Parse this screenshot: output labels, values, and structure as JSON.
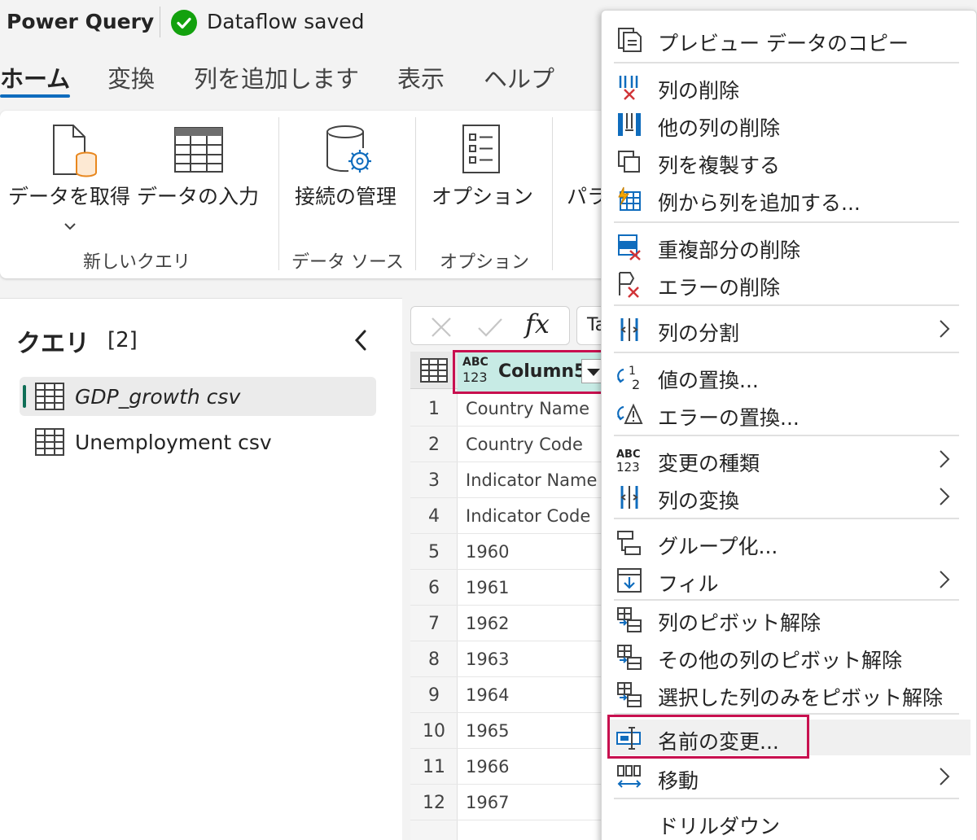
{
  "titlebar": {
    "app": "Power Query",
    "status": "Dataflow saved"
  },
  "tabs": [
    {
      "label": "ホーム",
      "active": true
    },
    {
      "label": "変換"
    },
    {
      "label": "列を追加します"
    },
    {
      "label": "表示"
    },
    {
      "label": "ヘルプ"
    }
  ],
  "ribbon": {
    "get_data": "データを取得",
    "enter_data": "データの入力",
    "manage_conn": "接続の管理",
    "options": "オプション",
    "param_partial": "パラ",
    "group_new_query": "新しいクエリ",
    "group_data_source": "データ ソース",
    "group_options": "オプション"
  },
  "queries": {
    "title": "クエリ",
    "count": "[2]",
    "items": [
      {
        "label": "GDP_growth csv",
        "selected": true
      },
      {
        "label": "Unemployment csv"
      }
    ]
  },
  "formula": {
    "fx": "fx",
    "text_partial": "Ta"
  },
  "grid": {
    "col_type_abc": "ABC",
    "col_type_123": "123",
    "col_name": "Column5",
    "rows": [
      {
        "n": "1",
        "v": "Country Name"
      },
      {
        "n": "2",
        "v": "Country Code"
      },
      {
        "n": "3",
        "v": "Indicator Name"
      },
      {
        "n": "4",
        "v": "Indicator Code"
      },
      {
        "n": "5",
        "v": "1960"
      },
      {
        "n": "6",
        "v": "1961"
      },
      {
        "n": "7",
        "v": "1962"
      },
      {
        "n": "8",
        "v": "1963"
      },
      {
        "n": "9",
        "v": "1964"
      },
      {
        "n": "10",
        "v": "1965"
      },
      {
        "n": "11",
        "v": "1966"
      },
      {
        "n": "12",
        "v": "1967"
      }
    ]
  },
  "menu": {
    "items": [
      {
        "label": "プレビュー データのコピー",
        "icon": "copy-preview-icon"
      },
      {
        "label": "列の削除",
        "icon": "remove-column-icon"
      },
      {
        "label": "他の列の削除",
        "icon": "remove-other-columns-icon"
      },
      {
        "label": "列を複製する",
        "icon": "duplicate-column-icon"
      },
      {
        "label": "例から列を追加する...",
        "icon": "column-from-examples-icon"
      },
      {
        "label": "重複部分の削除",
        "icon": "remove-duplicates-icon"
      },
      {
        "label": "エラーの削除",
        "icon": "remove-errors-icon"
      },
      {
        "label": "列の分割",
        "icon": "split-column-icon",
        "submenu": true
      },
      {
        "label": "値の置換...",
        "icon": "replace-values-icon"
      },
      {
        "label": "エラーの置換...",
        "icon": "replace-errors-icon"
      },
      {
        "label": "変更の種類",
        "icon": "change-type-icon",
        "submenu": true
      },
      {
        "label": "列の変換",
        "icon": "transform-column-icon",
        "submenu": true
      },
      {
        "label": "グループ化...",
        "icon": "group-by-icon"
      },
      {
        "label": "フィル",
        "icon": "fill-icon",
        "submenu": true
      },
      {
        "label": "列のピボット解除",
        "icon": "unpivot-icon"
      },
      {
        "label": "その他の列のピボット解除",
        "icon": "unpivot-other-icon"
      },
      {
        "label": "選択した列のみをピボット解除",
        "icon": "unpivot-selected-icon"
      },
      {
        "label": "名前の変更...",
        "icon": "rename-icon",
        "highlighted": true
      },
      {
        "label": "移動",
        "icon": "move-icon",
        "submenu": true
      },
      {
        "label": "ドリルダウン",
        "icon": ""
      }
    ]
  },
  "colors": {
    "accent": "#0f6cbd",
    "highlight_box": "#c8104f",
    "selected_header": "#c7ebe5",
    "saved_green": "#13a10e"
  }
}
